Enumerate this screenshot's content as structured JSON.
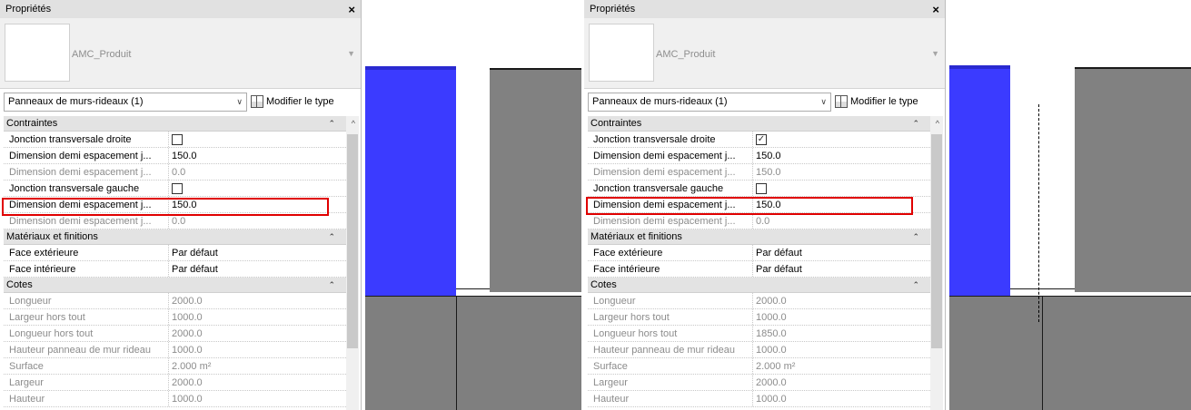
{
  "panels": [
    {
      "title": "Propriétés",
      "close_label": "×",
      "type_name": "AMC_Produit",
      "selector_value": "Panneaux de murs-rideaux (1)",
      "edit_type_label": "Modifier le type",
      "groups": {
        "constraints": "Contraintes",
        "materials": "Matériaux et finitions",
        "dimensions": "Cotes"
      },
      "constraints": [
        {
          "label": "Jonction transversale droite",
          "value": "",
          "checkbox": true,
          "checked": false,
          "dim": false
        },
        {
          "label": "Dimension demi espacement j...",
          "value": "150.0",
          "dim": false
        },
        {
          "label": "Dimension demi espacement j...",
          "value": "0.0",
          "dim": true
        },
        {
          "label": "Jonction transversale gauche",
          "value": "",
          "checkbox": true,
          "checked": false,
          "dim": false
        },
        {
          "label": "Dimension demi espacement j...",
          "value": "150.0",
          "dim": false
        },
        {
          "label": "Dimension demi espacement j...",
          "value": "0.0",
          "dim": true
        }
      ],
      "materials": [
        {
          "label": "Face extérieure",
          "value": "Par défaut"
        },
        {
          "label": "Face intérieure",
          "value": "Par défaut"
        }
      ],
      "dimensions": [
        {
          "label": "Longueur",
          "value": "2000.0"
        },
        {
          "label": "Largeur hors tout",
          "value": "1000.0"
        },
        {
          "label": "Longueur hors tout",
          "value": "2000.0"
        },
        {
          "label": "Hauteur panneau de mur rideau",
          "value": "1000.0"
        },
        {
          "label": "Surface",
          "value": "2.000 m²"
        },
        {
          "label": "Largeur",
          "value": "2000.0"
        },
        {
          "label": "Hauteur",
          "value": "1000.0"
        }
      ]
    },
    {
      "title": "Propriétés",
      "close_label": "×",
      "type_name": "AMC_Produit",
      "selector_value": "Panneaux de murs-rideaux (1)",
      "edit_type_label": "Modifier le type",
      "groups": {
        "constraints": "Contraintes",
        "materials": "Matériaux et finitions",
        "dimensions": "Cotes"
      },
      "constraints": [
        {
          "label": "Jonction transversale droite",
          "value": "",
          "checkbox": true,
          "checked": true,
          "dim": false
        },
        {
          "label": "Dimension demi espacement j...",
          "value": "150.0",
          "dim": false
        },
        {
          "label": "Dimension demi espacement j...",
          "value": "150.0",
          "dim": true
        },
        {
          "label": "Jonction transversale gauche",
          "value": "",
          "checkbox": true,
          "checked": false,
          "dim": false
        },
        {
          "label": "Dimension demi espacement j...",
          "value": "150.0",
          "dim": false
        },
        {
          "label": "Dimension demi espacement j...",
          "value": "0.0",
          "dim": true
        }
      ],
      "materials": [
        {
          "label": "Face extérieure",
          "value": "Par défaut"
        },
        {
          "label": "Face intérieure",
          "value": "Par défaut"
        }
      ],
      "dimensions": [
        {
          "label": "Longueur",
          "value": "2000.0"
        },
        {
          "label": "Largeur hors tout",
          "value": "1000.0"
        },
        {
          "label": "Longueur hors tout",
          "value": "1850.0"
        },
        {
          "label": "Hauteur panneau de mur rideau",
          "value": "1000.0"
        },
        {
          "label": "Surface",
          "value": "2.000 m²"
        },
        {
          "label": "Largeur",
          "value": "2000.0"
        },
        {
          "label": "Hauteur",
          "value": "1000.0"
        }
      ]
    }
  ],
  "colors": {
    "panel_blue": "#3b3bff",
    "wall_gray": "#818181",
    "highlight_red": "#e00000"
  }
}
